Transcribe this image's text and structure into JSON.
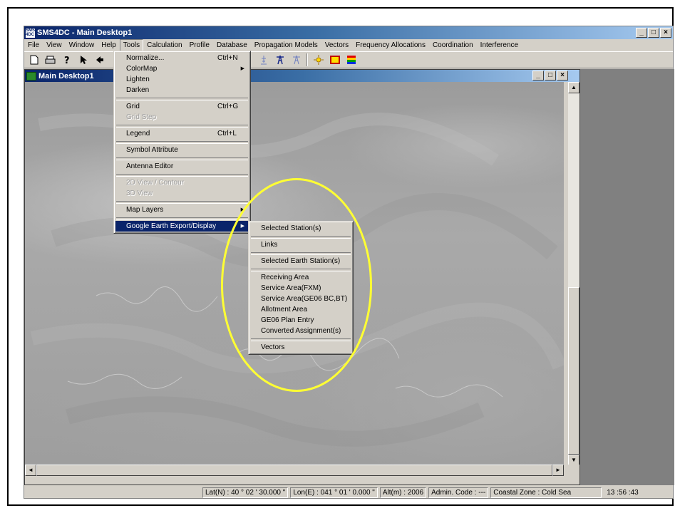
{
  "app": {
    "title": "SMS4DC - Main Desktop1",
    "logo_text": "SMS 4DC",
    "min_label": "_",
    "max_label": "□",
    "close_label": "×"
  },
  "menubar": {
    "items": [
      "File",
      "View",
      "Window",
      "Help",
      "Tools",
      "Calculation",
      "Profile",
      "Database",
      "Propagation Models",
      "Vectors",
      "Frequency Allocations",
      "Coordination",
      "Interference"
    ],
    "active": "Tools"
  },
  "toolbar": {
    "buttons": [
      "new-icon",
      "print-icon",
      "help-icon",
      "pointer-icon",
      "back-icon",
      "antenna-icon",
      "antenna-outline-icon",
      "tower-icon",
      "tower-outline-icon",
      "sun-icon",
      "layer-icon",
      "colormap-icon"
    ]
  },
  "child_window": {
    "title": "Main Desktop1"
  },
  "tools_menu": {
    "items": [
      {
        "label": "Normalize...",
        "shortcut": "Ctrl+N"
      },
      {
        "label": "ColorMap",
        "submenu": true
      },
      {
        "label": "Lighten"
      },
      {
        "label": "Darken"
      },
      {
        "separator": true
      },
      {
        "label": "Grid",
        "shortcut": "Ctrl+G"
      },
      {
        "label": "Grid Step",
        "disabled": true
      },
      {
        "separator": true
      },
      {
        "label": "Legend",
        "shortcut": "Ctrl+L"
      },
      {
        "separator": true
      },
      {
        "label": "Symbol Attribute"
      },
      {
        "separator": true
      },
      {
        "label": "Antenna Editor"
      },
      {
        "separator": true
      },
      {
        "label": "2D View / Contour",
        "disabled": true
      },
      {
        "label": "3D View",
        "disabled": true
      },
      {
        "separator": true
      },
      {
        "label": "Map Layers",
        "submenu": true
      },
      {
        "separator": true
      },
      {
        "label": "Google Earth Export/Display",
        "submenu": true,
        "highlighted": true
      }
    ]
  },
  "google_earth_submenu": {
    "items": [
      {
        "label": "Selected Station(s)"
      },
      {
        "separator": true
      },
      {
        "label": "Links"
      },
      {
        "separator": true
      },
      {
        "label": "Selected Earth Station(s)"
      },
      {
        "separator": true
      },
      {
        "label": "Receiving Area"
      },
      {
        "label": "Service Area(FXM)"
      },
      {
        "label": "Service Area(GE06 BC,BT)"
      },
      {
        "label": "Allotment Area"
      },
      {
        "label": "GE06 Plan Entry"
      },
      {
        "label": "Converted Assignment(s)"
      },
      {
        "separator": true
      },
      {
        "label": "Vectors"
      }
    ]
  },
  "statusbar": {
    "lat": "Lat(N) : 40 ° 02 ' 30.000 \"",
    "lon": "Lon(E) : 041 ° 01 ' 0.000 \"",
    "alt": "Alt(m) : 2006",
    "admin": "Admin. Code : ---",
    "coastal": "Coastal Zone : Cold Sea",
    "time": "13 :56 :43"
  },
  "colors": {
    "highlight_ellipse": "#ffff33",
    "title_active": "#0a246a",
    "menu_highlight": "#0a246a"
  }
}
